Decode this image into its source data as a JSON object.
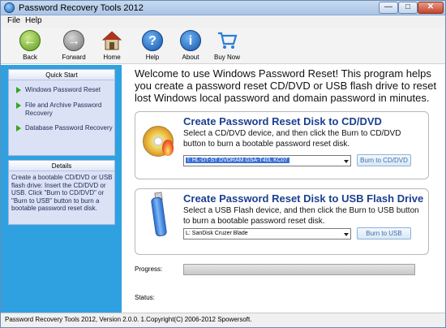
{
  "window": {
    "title": "Password Recovery Tools 2012"
  },
  "menu": {
    "file": "File",
    "help": "Help"
  },
  "toolbar": {
    "back": "Back",
    "forward": "Forward",
    "home": "Home",
    "help": "Help",
    "about": "About",
    "buy": "Buy Now"
  },
  "sidebar": {
    "quick_start_title": "Quick Start",
    "items": [
      {
        "label": "Windows Password Reset"
      },
      {
        "label": "File and Archive Password Recovery"
      },
      {
        "label": "Database Password Recovery"
      }
    ],
    "details_title": "Details",
    "details_text": "Create a bootable CD/DVD or USB flash drive: Insert the CD/DVD or USB. Click \"Burn to CD/DVD\" or \"Burn to USB\" button to burn a bootable password reset disk."
  },
  "main": {
    "welcome": "Welcome to use Windows Password Reset! This program helps you create a password reset CD/DVD or USB flash drive to reset lost Windows local password and domain password in minutes.",
    "cd": {
      "title": "Create Password Reset Disk to CD/DVD",
      "desc": "Select a CD/DVD device, and then click the Burn to CD/DVD button to burn a bootable password reset disk.",
      "device": "I: HL-DT-ST DVDRAM GSA-T40L KC07",
      "button": "Burn to CD/DVD"
    },
    "usb": {
      "title": "Create Password Reset Disk to USB Flash Drive",
      "desc": "Select a USB Flash device, and then click the Burn to USB button to burn a bootable password reset disk.",
      "device": "L: SanDisk Cruzer Blade",
      "button": "Burn to USB"
    },
    "progress_label": "Progress:",
    "status_label": "Status:"
  },
  "statusbar": {
    "text": "Password Recovery Tools 2012, Version 2.0.0. 1.Copyright(C) 2006-2012 Spowersoft."
  },
  "colors": {
    "sidebar_bg": "#2fa1e1",
    "card_title": "#1c3f8f",
    "selection": "#3a70d6"
  }
}
